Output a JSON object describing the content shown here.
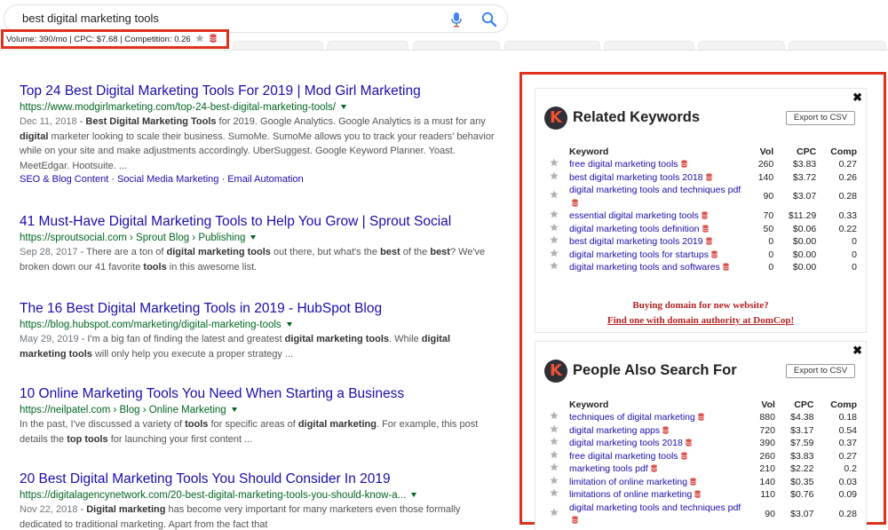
{
  "search": {
    "query": "best digital marketing tools",
    "mic_icon": "microphone-icon",
    "search_icon": "magnifier-icon",
    "colors": {
      "mic_blue": "#4285f4",
      "mic_red": "#ea4335"
    }
  },
  "metrics": {
    "text": "Volume: 390/mo | CPC: $7.68 | Competition: 0.26",
    "star_icon": "star-icon",
    "db_icon": "database-icon"
  },
  "results": [
    {
      "title": "Top 24 Best Digital Marketing Tools For 2019 | Mod Girl Marketing",
      "url": "https://www.modgirlmarketing.com/top-24-best-digital-marketing-tools/",
      "date": "Dec 11, 2018",
      "snippet_html": " - <b>Best Digital Marketing Tools</b> for 2019. Google Analytics. Google Analytics is a must for any <b>digital</b> marketer looking to scale their business. SumoMe. SumoMe allows you to track your readers' behavior while on your site and make adjustments accordingly. UberSuggest. Google Keyword Planner. Yoast. MeetEdgar. Hootsuite. ...",
      "links": [
        "SEO & Blog Content",
        "Social Media Marketing",
        "Email Automation"
      ]
    },
    {
      "title": "41 Must-Have Digital Marketing Tools to Help You Grow | Sprout Social",
      "url": "https://sproutsocial.com › Sprout Blog › Publishing",
      "date": "Sep 28, 2017",
      "snippet_html": " - There are a ton of <b>digital marketing tools</b> out there, but what's the <b>best</b> of the <b>best</b>? We've broken down our 41 favorite <b>tools</b> in this awesome list."
    },
    {
      "title": "The 16 Best Digital Marketing Tools in 2019 - HubSpot Blog",
      "url": "https://blog.hubspot.com/marketing/digital-marketing-tools",
      "date": "May 29, 2019",
      "snippet_html": " - I'm a big fan of finding the latest and greatest <b>digital marketing tools</b>. While <b>digital marketing tools</b> will only help you execute a proper strategy ..."
    },
    {
      "title": "10 Online Marketing Tools You Need When Starting a Business",
      "url": "https://neilpatel.com › Blog › Online Marketing",
      "date": "",
      "snippet_html": "In the past, I've discussed a variety of <b>tools</b> for specific areas of <b>digital marketing</b>. For example, this post details the <b>top tools</b> for launching your first content ..."
    },
    {
      "title": "20 Best Digital Marketing Tools You Should Consider In 2019",
      "url": "https://digitalagencynetwork.com/20-best-digital-marketing-tools-you-should-know-a...",
      "date": "Nov 22, 2018",
      "snippet_html": " - <b>Digital marketing</b> has become very important for many marketers even those formally dedicated to traditional marketing. Apart from the fact that"
    }
  ],
  "related": {
    "title": "Related Keywords",
    "export_label": "Export to CSV",
    "close_label": "✖",
    "logo_letter": "K",
    "headers": {
      "keyword": "Keyword",
      "vol": "Vol",
      "cpc": "CPC",
      "comp": "Comp"
    },
    "rows": [
      {
        "kw": "free digital marketing tools",
        "vol": "260",
        "cpc": "$3.83",
        "comp": "0.27"
      },
      {
        "kw": "best digital marketing tools 2018",
        "vol": "140",
        "cpc": "$3.72",
        "comp": "0.26"
      },
      {
        "kw": "digital marketing tools and techniques pdf",
        "vol": "90",
        "cpc": "$3.07",
        "comp": "0.28"
      },
      {
        "kw": "essential digital marketing tools",
        "vol": "70",
        "cpc": "$11.29",
        "comp": "0.33"
      },
      {
        "kw": "digital marketing tools definition",
        "vol": "50",
        "cpc": "$0.06",
        "comp": "0.22"
      },
      {
        "kw": "best digital marketing tools 2019",
        "vol": "0",
        "cpc": "$0.00",
        "comp": "0"
      },
      {
        "kw": "digital marketing tools for startups",
        "vol": "0",
        "cpc": "$0.00",
        "comp": "0"
      },
      {
        "kw": "digital marketing tools and softwares",
        "vol": "0",
        "cpc": "$0.00",
        "comp": "0"
      }
    ],
    "promo_line1": "Buying domain for new website?",
    "promo_line2": "Find one with domain authority at DomCop!"
  },
  "people": {
    "title": "People Also Search For",
    "export_label": "Export to CSV",
    "close_label": "✖",
    "logo_letter": "K",
    "headers": {
      "keyword": "Keyword",
      "vol": "Vol",
      "cpc": "CPC",
      "comp": "Comp"
    },
    "rows": [
      {
        "kw": "techniques of digital marketing",
        "vol": "880",
        "cpc": "$4.38",
        "comp": "0.18"
      },
      {
        "kw": "digital marketing apps",
        "vol": "720",
        "cpc": "$3.17",
        "comp": "0.54"
      },
      {
        "kw": "digital marketing tools 2018",
        "vol": "390",
        "cpc": "$7.59",
        "comp": "0.37"
      },
      {
        "kw": "free digital marketing tools",
        "vol": "260",
        "cpc": "$3.83",
        "comp": "0.27"
      },
      {
        "kw": "marketing tools pdf",
        "vol": "210",
        "cpc": "$2.22",
        "comp": "0.2"
      },
      {
        "kw": "limitation of online marketing",
        "vol": "140",
        "cpc": "$0.35",
        "comp": "0.03"
      },
      {
        "kw": "limitations of online marketing",
        "vol": "110",
        "cpc": "$0.76",
        "comp": "0.09"
      },
      {
        "kw": "digital marketing tools and techniques pdf",
        "vol": "90",
        "cpc": "$3.07",
        "comp": "0.28"
      }
    ]
  },
  "colors": {
    "highlight_red": "#e0301e",
    "link_blue": "#1a0dab",
    "url_green": "#006621",
    "promo_red": "#b22222"
  }
}
